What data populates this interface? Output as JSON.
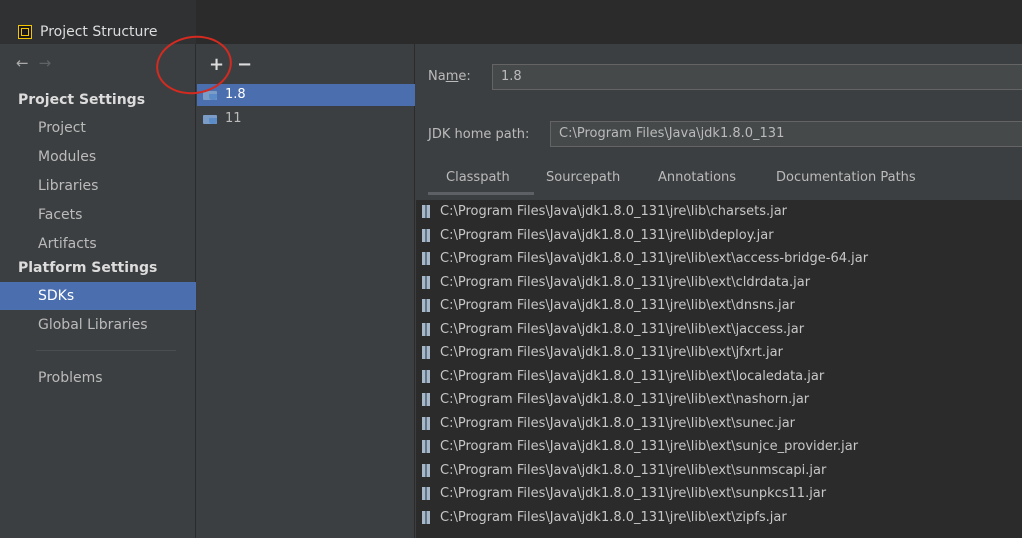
{
  "window": {
    "title": "Project Structure"
  },
  "nav": {
    "back": "←",
    "forward": "→",
    "project_settings_header": "Project Settings",
    "project_items": [
      "Project",
      "Modules",
      "Libraries",
      "Facets",
      "Artifacts"
    ],
    "platform_settings_header": "Platform Settings",
    "platform_items": [
      "SDKs",
      "Global Libraries"
    ],
    "selected": "SDKs",
    "problems": "Problems"
  },
  "sdk_list": {
    "add": "+",
    "remove": "−",
    "items": [
      "1.8",
      "11"
    ],
    "selected": "1.8"
  },
  "detail": {
    "name_label_pre": "Na",
    "name_label_mnemonic": "m",
    "name_label_post": "e:",
    "name_value": "1.8",
    "home_label": "JDK home path:",
    "home_value": "C:\\Program Files\\Java\\jdk1.8.0_131",
    "tabs": [
      "Classpath",
      "Sourcepath",
      "Annotations",
      "Documentation Paths"
    ],
    "active_tab": "Classpath",
    "classpath": [
      "C:\\Program Files\\Java\\jdk1.8.0_131\\jre\\lib\\charsets.jar",
      "C:\\Program Files\\Java\\jdk1.8.0_131\\jre\\lib\\deploy.jar",
      "C:\\Program Files\\Java\\jdk1.8.0_131\\jre\\lib\\ext\\access-bridge-64.jar",
      "C:\\Program Files\\Java\\jdk1.8.0_131\\jre\\lib\\ext\\cldrdata.jar",
      "C:\\Program Files\\Java\\jdk1.8.0_131\\jre\\lib\\ext\\dnsns.jar",
      "C:\\Program Files\\Java\\jdk1.8.0_131\\jre\\lib\\ext\\jaccess.jar",
      "C:\\Program Files\\Java\\jdk1.8.0_131\\jre\\lib\\ext\\jfxrt.jar",
      "C:\\Program Files\\Java\\jdk1.8.0_131\\jre\\lib\\ext\\localedata.jar",
      "C:\\Program Files\\Java\\jdk1.8.0_131\\jre\\lib\\ext\\nashorn.jar",
      "C:\\Program Files\\Java\\jdk1.8.0_131\\jre\\lib\\ext\\sunec.jar",
      "C:\\Program Files\\Java\\jdk1.8.0_131\\jre\\lib\\ext\\sunjce_provider.jar",
      "C:\\Program Files\\Java\\jdk1.8.0_131\\jre\\lib\\ext\\sunmscapi.jar",
      "C:\\Program Files\\Java\\jdk1.8.0_131\\jre\\lib\\ext\\sunpkcs11.jar",
      "C:\\Program Files\\Java\\jdk1.8.0_131\\jre\\lib\\ext\\zipfs.jar"
    ]
  },
  "colors": {
    "selection": "#4b6eaf",
    "annotation": "#d42a20",
    "app_icon": "#f2c500"
  }
}
